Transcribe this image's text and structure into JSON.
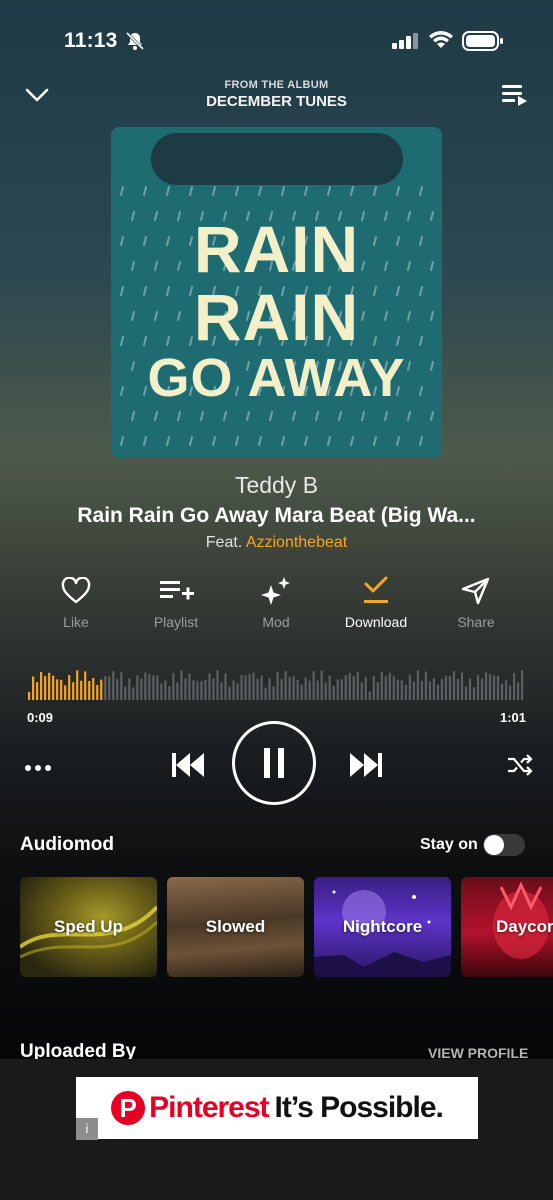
{
  "status_bar": {
    "time": "11:13"
  },
  "header": {
    "subtitle": "FROM THE ALBUM",
    "album": "DECEMBER TUNES"
  },
  "cover": {
    "lines": [
      "RAIN",
      "RAIN",
      "GO AWAY"
    ]
  },
  "track": {
    "artist": "Teddy B",
    "title": "Rain Rain Go Away Mara Beat (Big Wa...",
    "feat_prefix": "Feat.",
    "feat_artist": "Azzionthebeat"
  },
  "actions": [
    {
      "label": "Like",
      "icon": "heart-icon"
    },
    {
      "label": "Playlist",
      "icon": "playlist-add-icon"
    },
    {
      "label": "Mod",
      "icon": "sparkle-icon"
    },
    {
      "label": "Download",
      "icon": "download-icon"
    },
    {
      "label": "Share",
      "icon": "send-icon"
    }
  ],
  "player": {
    "elapsed": "0:09",
    "duration": "1:01",
    "progress": 0.15
  },
  "audiomod": {
    "title": "Audiomod",
    "stay_on_label": "Stay on",
    "stay_on": false,
    "cards": [
      "Sped Up",
      "Slowed",
      "Nightcore",
      "Daycore"
    ]
  },
  "uploaded": {
    "title": "Uploaded By",
    "view_profile": "VIEW PROFILE"
  },
  "ad": {
    "brand": "Pinterest",
    "tagline": "It’s Possible."
  },
  "colors": {
    "accent": "#f5a623",
    "pinterest_red": "#e60023"
  }
}
